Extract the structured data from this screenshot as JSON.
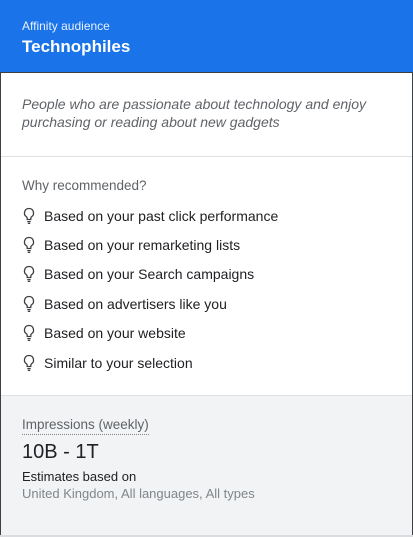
{
  "header": {
    "eyebrow": "Affinity audience",
    "title": "Technophiles",
    "background_color": "#1a73e8"
  },
  "description": "People who are passionate about technology and enjoy purchasing or reading about new gadgets",
  "reasons": {
    "heading": "Why recommended?",
    "icon": "lightbulb-icon",
    "items": [
      {
        "label": "Based on your past click performance"
      },
      {
        "label": "Based on your remarketing lists"
      },
      {
        "label": "Based on your Search campaigns"
      },
      {
        "label": "Based on advertisers like you"
      },
      {
        "label": "Based on your website"
      },
      {
        "label": "Similar to your selection"
      }
    ]
  },
  "stats": {
    "impressions_label": "Impressions (weekly)",
    "impressions_value": "10B - 1T",
    "estimates_label": "Estimates based on",
    "estimates_value": "United Kingdom, All languages, All types"
  }
}
